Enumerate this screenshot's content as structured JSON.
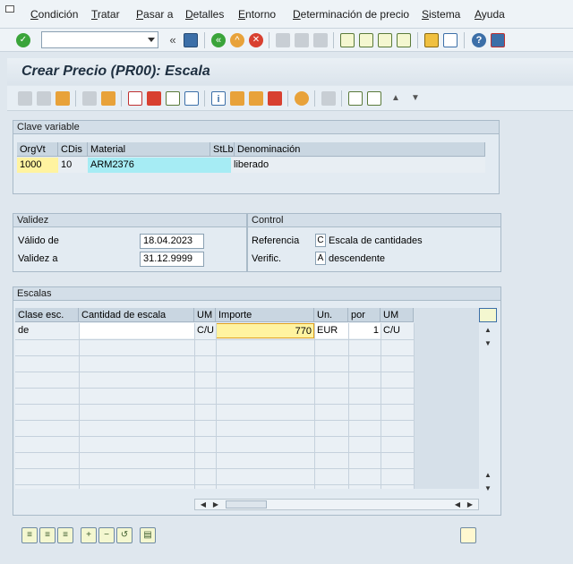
{
  "menu": [
    "Condición",
    "Tratar",
    "Pasar a",
    "Detalles",
    "Entorno",
    "Determinación de precio",
    "Sistema",
    "Ayuda"
  ],
  "title": "Crear Precio (PR00): Escala",
  "clave": {
    "title": "Clave variable",
    "headers": [
      "OrgVt",
      "CDis",
      "Material",
      "StLb",
      "Denominación"
    ],
    "row": [
      "1000",
      "10",
      "ARM2376",
      "",
      "liberado"
    ]
  },
  "validez": {
    "title": "Validez",
    "from_label": "Válido de",
    "from_value": "18.04.2023",
    "to_label": "Validez a",
    "to_value": "31.12.9999"
  },
  "control": {
    "title": "Control",
    "ref_label": "Referencia",
    "ref_code": "C",
    "ref_text": "Escala de cantidades",
    "verif_label": "Verific.",
    "verif_code": "A",
    "verif_text": "descendente"
  },
  "escalas": {
    "title": "Escalas",
    "headers": [
      "Clase esc.",
      "Cantidad de escala",
      "UM",
      "Importe",
      "Un.",
      "por",
      "UM"
    ],
    "row": [
      "de",
      "",
      "C/U",
      "770",
      "EUR",
      "1",
      "C/U"
    ]
  },
  "colors": {
    "highlight_yellow": "#fff3a0",
    "highlight_cyan": "#a6ecf4",
    "title_color": "#1e2f40"
  }
}
